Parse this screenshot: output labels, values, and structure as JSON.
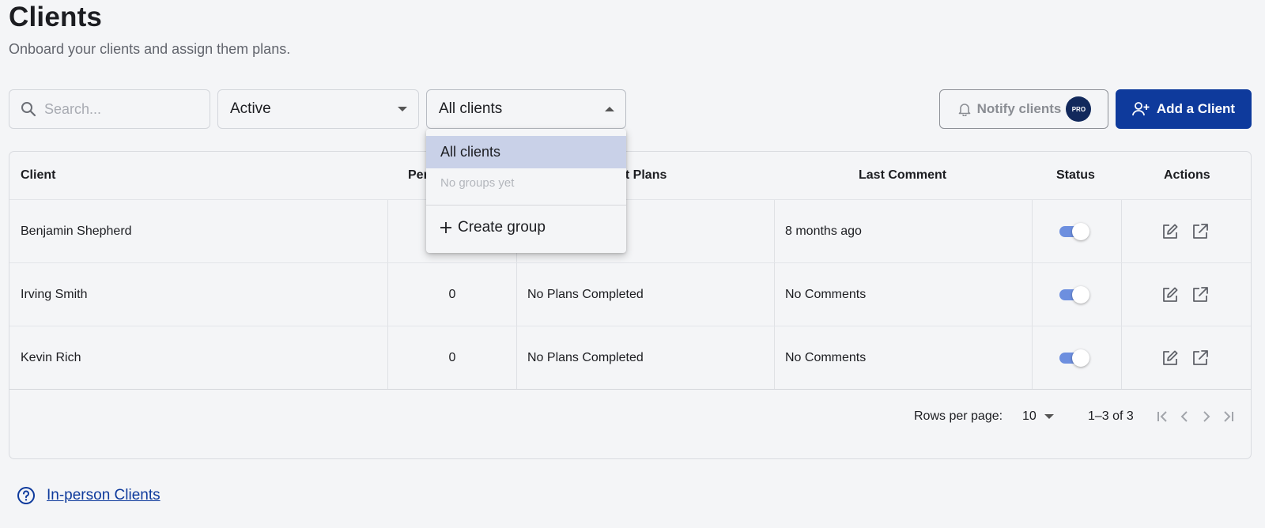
{
  "page": {
    "title": "Clients",
    "subtitle": "Onboard your clients and assign them plans."
  },
  "toolbar": {
    "search_placeholder": "Search...",
    "status_filter_value": "Active",
    "group_filter_value": "All clients",
    "notify_label": "Notify clients",
    "pro_badge": "PRO",
    "add_label": "Add a Client"
  },
  "table": {
    "headers": {
      "client": "Client",
      "personal": "Per",
      "last_plans": "st Plans",
      "last_comment": "Last Comment",
      "status": "Status",
      "actions": "Actions"
    },
    "rows": [
      {
        "name": "Benjamin Shepherd",
        "personal": "",
        "plans": "",
        "comment": "8 months ago",
        "active": true
      },
      {
        "name": "Irving Smith",
        "personal": "0",
        "plans": "No Plans Completed",
        "comment": "No Comments",
        "active": true
      },
      {
        "name": "Kevin Rich",
        "personal": "0",
        "plans": "No Plans Completed",
        "comment": "No Comments",
        "active": true
      }
    ],
    "pagination": {
      "rows_per_page_label": "Rows per page:",
      "rows_per_page_value": "10",
      "range": "1–3 of 3"
    }
  },
  "group_menu": {
    "selected": "All clients",
    "empty_text": "No groups yet",
    "create_label": "Create group"
  },
  "help_link": "In-person Clients",
  "colors": {
    "primary": "#0e3a9c",
    "toggle_on": "#6d8fdf",
    "menu_selected": "#c9d1e8"
  }
}
